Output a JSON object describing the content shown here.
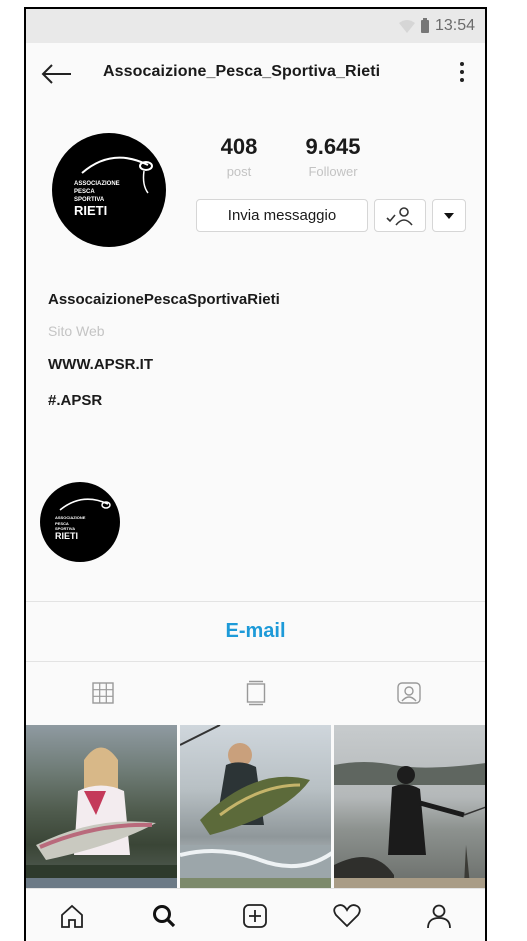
{
  "status_bar": {
    "time": "13:54"
  },
  "header": {
    "username": "Assocaizione_Pesca_Sportiva_Rieti"
  },
  "profile": {
    "logo_text": [
      "ASSOCIAZIONE",
      "PESCA",
      "SPORTIVA",
      "RIETI"
    ],
    "stats": [
      {
        "value": "408",
        "label": "post"
      },
      {
        "value": "9.645",
        "label": "Follower"
      }
    ],
    "message_button": "Invia messaggio"
  },
  "bio": {
    "name": "AssocaizionePescaSportivaRieti",
    "category": "Sito Web",
    "website": "WWW.APSR.IT",
    "hashtag": "#.APSR"
  },
  "contact": {
    "email_label": "E-mail"
  },
  "colors": {
    "accent": "#1d9ad8",
    "muted": "#c4c4c4",
    "background": "#fafafa"
  }
}
